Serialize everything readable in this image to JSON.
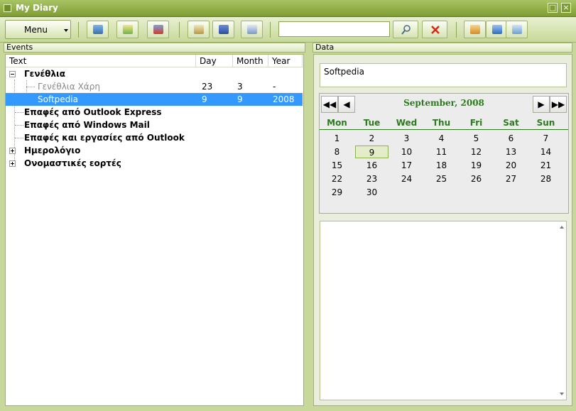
{
  "window": {
    "title": "My Diary"
  },
  "toolbar": {
    "menu_label": "Menu",
    "search_value": "",
    "icons": [
      "add-event-icon",
      "add-note-icon",
      "delete-event-icon",
      "book-icon",
      "flag-icon",
      "export-icon",
      "search-icon",
      "clear-search-icon",
      "settings-icon",
      "sync-icon",
      "picture-icon"
    ]
  },
  "events": {
    "header": "Events",
    "columns": [
      "Text",
      "Day",
      "Month",
      "Year"
    ],
    "rows": [
      {
        "text": "Γενέθλια",
        "day": "",
        "month": "",
        "year": ""
      },
      {
        "text": "Γενέθλια Χάρη",
        "day": "23",
        "month": "3",
        "year": "-"
      },
      {
        "text": "Softpedia",
        "day": "9",
        "month": "9",
        "year": "2008"
      },
      {
        "text": "Επαφές από Outlook Express",
        "day": "",
        "month": "",
        "year": ""
      },
      {
        "text": "Επαφές από Windows Mail",
        "day": "",
        "month": "",
        "year": ""
      },
      {
        "text": "Επαφές και εργασίες από Outlook",
        "day": "",
        "month": "",
        "year": ""
      },
      {
        "text": "Ημερολόγιο",
        "day": "",
        "month": "",
        "year": ""
      },
      {
        "text": "Ονομαστικές εορτές",
        "day": "",
        "month": "",
        "year": ""
      }
    ]
  },
  "data_panel": {
    "header": "Data",
    "note": "Softpedia",
    "details": ""
  },
  "calendar": {
    "title": "September, 2008",
    "weekdays": [
      "Mon",
      "Tue",
      "Wed",
      "Thu",
      "Fri",
      "Sat",
      "Sun"
    ],
    "weeks": [
      [
        "1",
        "2",
        "3",
        "4",
        "5",
        "6",
        "7"
      ],
      [
        "8",
        "9",
        "10",
        "11",
        "12",
        "13",
        "14"
      ],
      [
        "15",
        "16",
        "17",
        "18",
        "19",
        "20",
        "21"
      ],
      [
        "22",
        "23",
        "24",
        "25",
        "26",
        "27",
        "28"
      ],
      [
        "29",
        "30",
        "",
        "",
        "",
        "",
        ""
      ]
    ],
    "selected_day": "9",
    "nav": {
      "prev_year": "◀◀",
      "prev_month": "◀",
      "next_month": "▶",
      "next_year": "▶▶"
    }
  },
  "colors": {
    "accent": "#7f9c34",
    "selection": "#3399ff",
    "calendar_green": "#2d7a1e"
  }
}
